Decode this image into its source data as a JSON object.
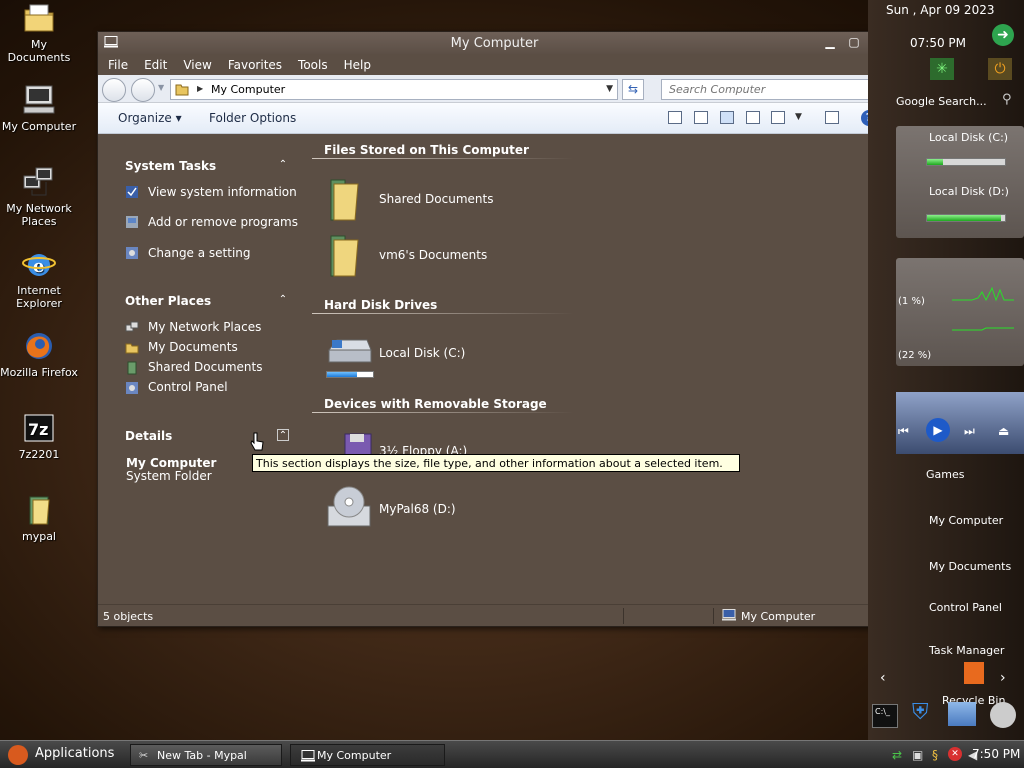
{
  "desktop": {
    "icons": [
      {
        "label": "My Documents"
      },
      {
        "label": "My Computer"
      },
      {
        "label": "My Network Places"
      },
      {
        "label": "Internet Explorer"
      },
      {
        "label": "Mozilla Firefox"
      },
      {
        "label": "7z2201"
      },
      {
        "label": "mypal"
      }
    ]
  },
  "window": {
    "title": "My Computer",
    "menu": [
      "File",
      "Edit",
      "View",
      "Favorites",
      "Tools",
      "Help"
    ],
    "address": "My Computer",
    "search_placeholder": "Search Computer",
    "toolbar": {
      "organize": "Organize",
      "folder_options": "Folder Options"
    },
    "system_tasks": {
      "title": "System Tasks",
      "items": [
        "View system information",
        "Add or remove programs",
        "Change a setting"
      ]
    },
    "other_places": {
      "title": "Other Places",
      "items": [
        "My Network Places",
        "My Documents",
        "Shared Documents",
        "Control Panel"
      ]
    },
    "details": {
      "title": "Details",
      "name": "My Computer",
      "type": "System Folder"
    },
    "groups": {
      "files": {
        "title": "Files Stored on This Computer",
        "items": [
          "Shared Documents",
          "vm6's Documents"
        ]
      },
      "hdd": {
        "title": "Hard Disk Drives",
        "items": [
          "Local Disk (C:)"
        ],
        "usage": 0.65
      },
      "removable": {
        "title": "Devices with Removable Storage",
        "items": [
          "3½ Floppy (A:)",
          "MyPal68 (D:)"
        ]
      }
    },
    "tooltip": "This section displays the size, file type, and other information about a selected item.",
    "status": {
      "count": "5 objects",
      "location": "My Computer"
    }
  },
  "sidebar": {
    "date": "Sun , Apr 09 2023",
    "time": "07:50 PM",
    "google_search": "Google Search...",
    "disk_c": {
      "label": "Local Disk (C:)",
      "fill": 0.2
    },
    "disk_d": {
      "label": "Local Disk (D:)",
      "fill": 0.95
    },
    "cpu": "(1 %)",
    "ram": "(22 %)",
    "menu": [
      "Games",
      "My Computer",
      "My Documents",
      "Control Panel",
      "Task Manager",
      "Recycle Bin"
    ]
  },
  "taskbar": {
    "applications": "Applications",
    "tasks": [
      "New Tab - Mypal",
      "My Computer"
    ],
    "clock": "7:50 PM"
  }
}
